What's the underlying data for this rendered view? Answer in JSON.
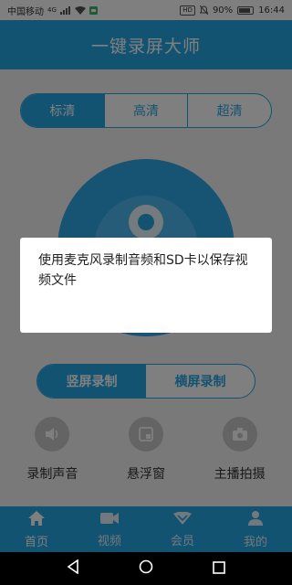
{
  "status_bar": {
    "carrier": "中国移动",
    "network_badge": "4G",
    "hd_badge": "HD",
    "battery": "90%",
    "time": "16:44"
  },
  "header": {
    "title": "一键录屏大师"
  },
  "quality_tabs": [
    {
      "label": "标清",
      "active": true
    },
    {
      "label": "高清",
      "active": false
    },
    {
      "label": "超清",
      "active": false
    }
  ],
  "orientation_tabs": [
    {
      "label": "竖屏录制",
      "active": true
    },
    {
      "label": "横屏录制",
      "active": false
    }
  ],
  "features": [
    {
      "label": "录制声音",
      "icon": "speaker-icon"
    },
    {
      "label": "悬浮窗",
      "icon": "floating-window-icon"
    },
    {
      "label": "主播拍摄",
      "icon": "camera-icon"
    }
  ],
  "bottom_nav": [
    {
      "label": "首页",
      "icon": "home-icon",
      "active": true
    },
    {
      "label": "视频",
      "icon": "video-icon",
      "active": false
    },
    {
      "label": "会员",
      "icon": "vip-icon",
      "active": false
    },
    {
      "label": "我的",
      "icon": "profile-icon",
      "active": false
    }
  ],
  "dialog": {
    "message": "使用麦克风录制音频和SD卡以保存视频文件"
  },
  "colors": {
    "accent": "#27a6e4",
    "overlay": "rgba(0,0,0,0.5)"
  }
}
